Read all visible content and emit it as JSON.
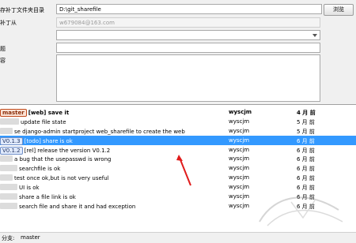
{
  "form": {
    "dir_label": "存补丁文件夹目录",
    "dir_value": "D:\\git_sharefile",
    "browse_label": "浏览",
    "from_label": "补丁从",
    "from_value": "w679084@163.com",
    "title_label": "题",
    "desc_label": "容"
  },
  "log": {
    "rows": [
      {
        "ref": "master",
        "ref_kind": "branch",
        "message": "[web] save it",
        "author": "wyscjm",
        "date": "4 月 前",
        "bold": true,
        "selected": false,
        "hidden_lead": 0
      },
      {
        "ref": "",
        "ref_kind": "",
        "message": "update file state",
        "author": "wyscjm",
        "date": "5 月 前",
        "bold": false,
        "selected": false,
        "hidden_lead": 24
      },
      {
        "ref": "",
        "ref_kind": "",
        "message": "se django-admin startproject web_sharefile to create the web",
        "author": "wyscjm",
        "date": "5 月 前",
        "bold": false,
        "selected": false,
        "hidden_lead": 16
      },
      {
        "ref": "V0.1.3",
        "ref_kind": "tag",
        "message": "[todo] share is ok",
        "author": "wyscjm",
        "date": "6 月 前",
        "bold": false,
        "selected": true,
        "hidden_lead": 0
      },
      {
        "ref": "V0.1.2",
        "ref_kind": "tag",
        "message": "[rel] release the version V0.1.2",
        "author": "wyscjm",
        "date": "6 月 前",
        "bold": false,
        "selected": false,
        "hidden_lead": 0
      },
      {
        "ref": "",
        "ref_kind": "",
        "message": "a bug that the usepasswd is wrong",
        "author": "wyscjm",
        "date": "6 月 前",
        "bold": false,
        "selected": false,
        "hidden_lead": 16
      },
      {
        "ref": "",
        "ref_kind": "",
        "message": "searchfile is ok",
        "author": "wyscjm",
        "date": "6 月 前",
        "bold": false,
        "selected": false,
        "hidden_lead": 22
      },
      {
        "ref": "",
        "ref_kind": "",
        "message": "test once ok,but is not very useful",
        "author": "wyscjm",
        "date": "6 月 前",
        "bold": false,
        "selected": false,
        "hidden_lead": 16
      },
      {
        "ref": "",
        "ref_kind": "",
        "message": "UI is ok",
        "author": "wyscjm",
        "date": "6 月 前",
        "bold": false,
        "selected": false,
        "hidden_lead": 22
      },
      {
        "ref": "",
        "ref_kind": "",
        "message": "share a file link is ok",
        "author": "wyscjm",
        "date": "6 月 前",
        "bold": false,
        "selected": false,
        "hidden_lead": 22
      },
      {
        "ref": "",
        "ref_kind": "",
        "message": "search file and share it and had exception",
        "author": "wyscjm",
        "date": "6 月 前",
        "bold": false,
        "selected": false,
        "hidden_lead": 22
      }
    ]
  },
  "status": {
    "branch_label": "分支:",
    "branch_value": "master"
  },
  "colors": {
    "selection": "#3399ff",
    "arrow": "#e01b1b"
  }
}
